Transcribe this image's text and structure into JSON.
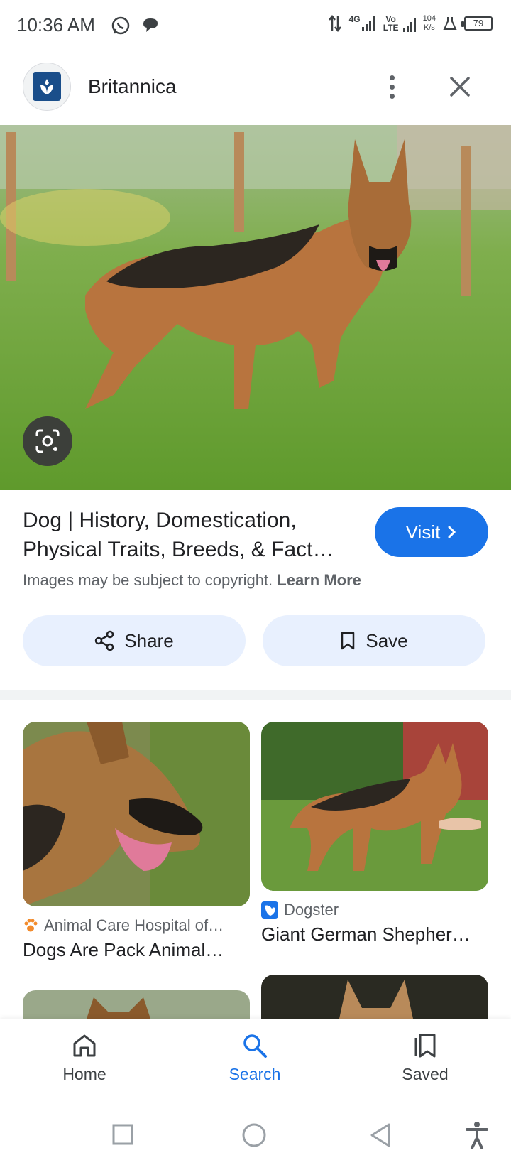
{
  "status": {
    "time": "10:36 AM",
    "net_4g": "4G",
    "net_volte": "Vo LTE",
    "speed_value": "104",
    "speed_unit": "K/s",
    "battery": "79"
  },
  "header": {
    "site_name": "Britannica"
  },
  "result": {
    "title_line1": "Dog | History, Domestication,",
    "title_line2": "Physical Traits, Breeds, & Fact…",
    "visit_label": "Visit",
    "copyright_text": "Images may be subject to copyright.",
    "learn_more": "Learn More"
  },
  "actions": {
    "share_label": "Share",
    "save_label": "Save"
  },
  "related": [
    {
      "source": "Animal Care Hospital of…",
      "title": "Dogs Are Pack Animal…"
    },
    {
      "source": "Dogster",
      "title": "Giant German Shepher…"
    }
  ],
  "bottom_nav": {
    "home": "Home",
    "search": "Search",
    "saved": "Saved"
  },
  "colors": {
    "accent": "#1a73e8",
    "chip_bg": "#e8f0fe"
  }
}
